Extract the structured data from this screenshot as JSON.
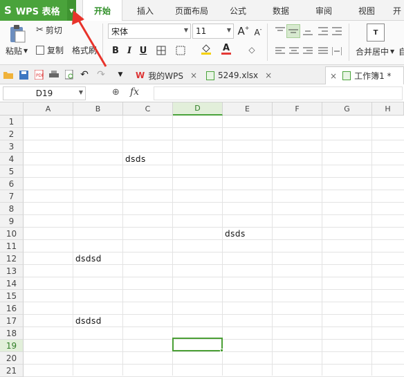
{
  "app": {
    "title": "WPS 表格",
    "logo": "S"
  },
  "menu": {
    "tabs": [
      "开始",
      "插入",
      "页面布局",
      "公式",
      "数据",
      "审阅",
      "视图",
      "开"
    ],
    "active": "开始"
  },
  "ribbon": {
    "paste_label": "粘贴",
    "cut_label": "剪切",
    "copy_label": "复制",
    "format_painter_label": "格式刷",
    "font_name": "宋体",
    "font_size": "11",
    "bold": "B",
    "italic": "I",
    "underline": "U",
    "grow_font": "A",
    "shrink_font": "A",
    "font_color_glyph": "A",
    "merge_label": "合并居中",
    "wrap_label": "自"
  },
  "doc_tabs": [
    {
      "label": "我的WPS",
      "active": false
    },
    {
      "label": "5249.xlsx",
      "active": false
    },
    {
      "label": "工作簿1 *",
      "active": true
    }
  ],
  "formula_bar": {
    "name_box": "D19",
    "fx": "fx",
    "value": ""
  },
  "grid": {
    "columns": [
      "A",
      "B",
      "C",
      "D",
      "E",
      "F",
      "G",
      "H"
    ],
    "selected_column": "D",
    "rows": [
      "1",
      "2",
      "3",
      "4",
      "5",
      "6",
      "7",
      "8",
      "9",
      "10",
      "11",
      "12",
      "13",
      "14",
      "15",
      "16",
      "17",
      "18",
      "19",
      "20",
      "21"
    ],
    "selected_row": "19",
    "cells": [
      {
        "ref": "C4",
        "value": "dsds"
      },
      {
        "ref": "E10",
        "value": "dsds"
      },
      {
        "ref": "B12",
        "value": "dsdsd"
      },
      {
        "ref": "B17",
        "value": "dsdsd"
      }
    ]
  },
  "colors": {
    "brand_green": "#4aa33b",
    "annotation_red": "#e8332b"
  }
}
